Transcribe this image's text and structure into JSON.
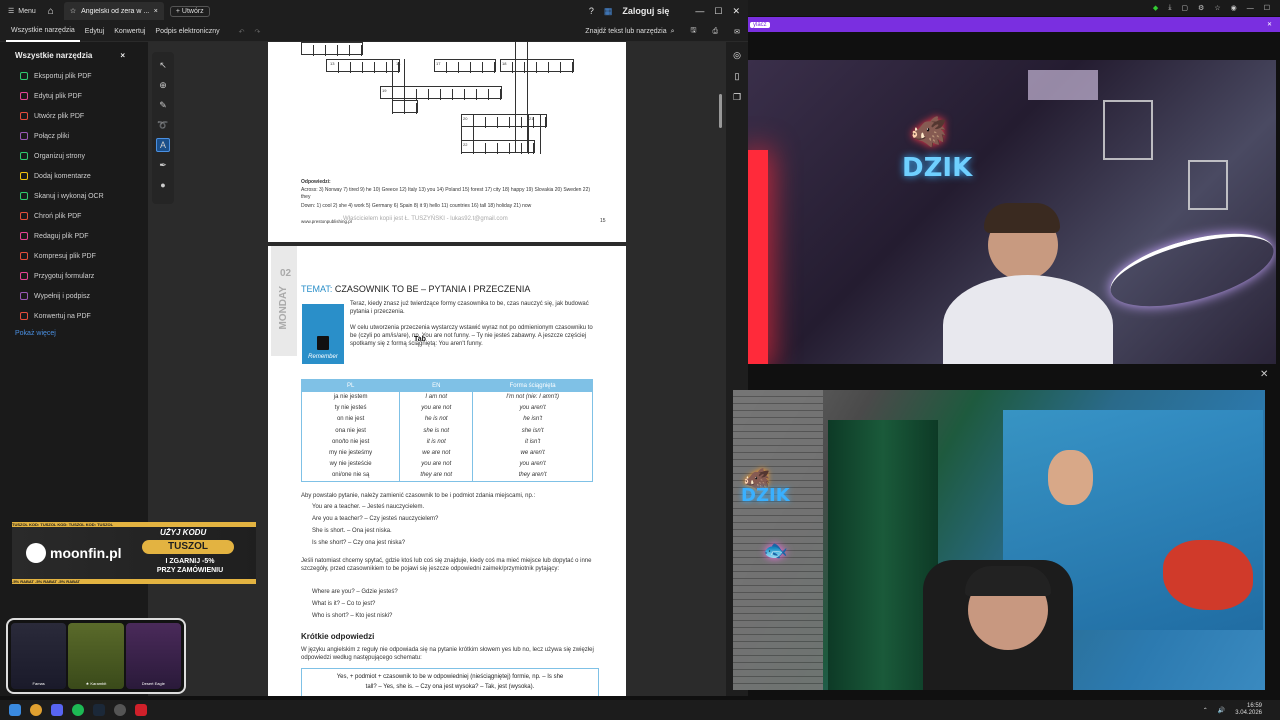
{
  "titlebar": {
    "menu_label": "Menu",
    "tab_title": "Angielski od zera w ...",
    "new_label": "Utwórz",
    "sign_in": "Zaloguj się"
  },
  "toolbar": {
    "tabs": [
      "Wszystkie narzędzia",
      "Edytuj",
      "Konwertuj",
      "Podpis elektroniczny"
    ],
    "find_label": "Znajdź tekst lub narzędzia"
  },
  "leftpanel": {
    "title": "Wszystkie narzędzia",
    "items": [
      {
        "label": "Eksportuj plik PDF",
        "color": "#2ecc71"
      },
      {
        "label": "Edytuj plik PDF",
        "color": "#e84393"
      },
      {
        "label": "Utwórz plik PDF",
        "color": "#e74c3c"
      },
      {
        "label": "Połącz pliki",
        "color": "#9b59b6"
      },
      {
        "label": "Organizuj strony",
        "color": "#2ecc71"
      },
      {
        "label": "Dodaj komentarze",
        "color": "#f1c40f"
      },
      {
        "label": "Skanuj i wykonaj OCR",
        "color": "#2ecc71"
      },
      {
        "label": "Chroń plik PDF",
        "color": "#e74c3c"
      },
      {
        "label": "Redaguj plik PDF",
        "color": "#e84393"
      },
      {
        "label": "Kompresuj plik PDF",
        "color": "#e74c3c"
      },
      {
        "label": "Przygotuj formularz",
        "color": "#e84393"
      },
      {
        "label": "Wypełnij i podpisz",
        "color": "#9b59b6"
      },
      {
        "label": "Konwertuj na PDF",
        "color": "#e74c3c"
      }
    ],
    "more": "Pokaż więcej"
  },
  "page1": {
    "answers_title": "Odpowiedzi:",
    "across": "Across: 3) Norway 7) tired 9) he 10) Greece 12) Italy 13) you 14) Poland 15) forest 17) city 18) happy 19) Slovakia 20) Sweden 22) they",
    "down": "Down: 1) cool 2) she 4) work 5) Germany 6) Spain 8) it 9) hello 11) countries 16) tall 18) holiday 21) now",
    "footer": "www.prestonpublishing.pl",
    "watermark": "Właścicielem kopii jest Ł. TUSZYŃSKI - lukas92.t@gmail.com",
    "page_num": "15"
  },
  "page2": {
    "day": "MONDAY",
    "week": "02",
    "temat_label": "TEMAT:",
    "temat_text": "CZASOWNIK TO BE – PYTANIA I PRZECZENIA",
    "remember": "Remember",
    "intro": "Teraz, kiedy znasz już twierdzące formy czasownika to be, czas nauczyć się, jak budować pytania i przeczenia.",
    "rule": "W celu utworzenia przeczenia wystarczy wstawić wyraz not po odmienionym czasowniku to be (czyli po am/is/are), np. You are not funny. – Ty nie jesteś zabawny. A jeszcze częściej spotkamy się z formą ściągniętą: You aren't funny.",
    "table_headers": [
      "PL",
      "EN",
      "Forma ściągnięta"
    ],
    "table_rows": [
      [
        "ja nie jestem",
        "I am not",
        "I'm not (nie: I amn't)"
      ],
      [
        "ty nie jesteś",
        "you are not",
        "you aren't"
      ],
      [
        "on nie jest",
        "he is not",
        "he isn't"
      ],
      [
        "ona nie jest",
        "she is not",
        "she isn't"
      ],
      [
        "ono/to nie jest",
        "it is not",
        "it isn't"
      ],
      [
        "my nie jesteśmy",
        "we are not",
        "we aren't"
      ],
      [
        "wy nie jesteście",
        "you are not",
        "you aren't"
      ],
      [
        "oni/one nie są",
        "they are not",
        "they aren't"
      ]
    ],
    "q_intro": "Aby powstało pytanie, należy zamienić czasownik to be i podmiot zdania miejscami, np.:",
    "q_examples": [
      "You are a teacher. – Jesteś nauczycielem.",
      "Are you a teacher? – Czy jesteś nauczycielem?",
      "She is short. – Ona jest niska.",
      "Is she short? – Czy ona jest niska?"
    ],
    "wh_intro": "Jeśli natomiast chcemy spytać, gdzie ktoś lub coś się znajduje, kiedy coś ma mieć miejsce lub dopytać o inne szczegóły, przed czasownikiem to be pojawi się jeszcze odpowiedni zaimek/przymiotnik pytający:",
    "wh_examples": [
      "Where are you? – Gdzie jesteś?",
      "What is it? – Co to jest?",
      "Who is short? – Kto jest niski?"
    ],
    "short_title": "Krótkie odpowiedzi",
    "short_text": "W języku angielskim z reguły nie odpowiada się na pytanie krótkim słowem yes lub no, lecz używa się zwięzłej odpowiedzi według następującego schematu:",
    "box_line1": "Yes, + podmiot + czasownik to be w odpowiedniej (nieściągniętej) formie, np. – Is she",
    "box_line2": "tall? – Yes, she is. – Czy ona jest wysoka? – Tak, jest (wysoka).",
    "cursor_text": "Tab"
  },
  "ad": {
    "top_strip": "TUSZOL KOD: TUSZOL KOD: TUSZOL KOD: TUSZOL",
    "brand": "moonfin.pl",
    "use_code": "UŻYJ KODU",
    "code": "TUSZOL",
    "sub1": "I ZGARNIJ -5%",
    "sub2": "PRZY ZAMÓWIENIU",
    "bottom_strip": "-5% RABAT -5% RABAT -5% RABAT"
  },
  "card": {
    "items": [
      "Famas",
      "★ Karambit",
      "Desert Eagle"
    ]
  },
  "stream": {
    "purple_label": "ylacz",
    "neon_brand": "DZIK"
  },
  "taskbar": {
    "time": "16:59",
    "date": "3.04.2026"
  }
}
